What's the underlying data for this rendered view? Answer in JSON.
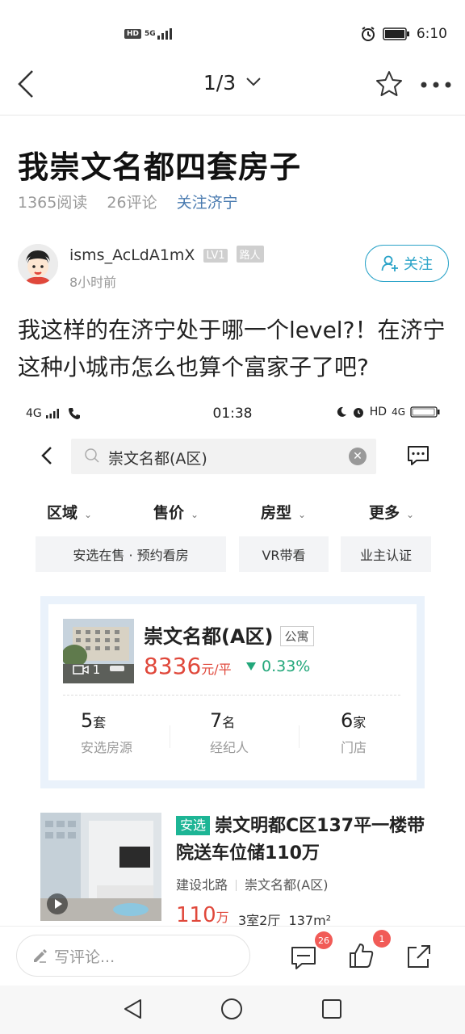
{
  "status_bar": {
    "hd": "HD",
    "network": "5G",
    "time": "6:10"
  },
  "nav": {
    "page_indicator": "1/3",
    "icons": [
      "back-icon",
      "chevron-down-icon",
      "star-icon",
      "more-icon"
    ]
  },
  "article": {
    "title": "我崇文名都四套房子",
    "reads": "1365阅读",
    "comments": "26评论",
    "follow_link": "关注济宁",
    "author": {
      "name": "isms_AcLdA1mX",
      "level": "LV1",
      "role": "路人",
      "time": "8小时前",
      "follow_label": "关注"
    },
    "body": "我这样的在济宁处于哪一个level?！在济宁这种小城市怎么也算个富家子了吧?"
  },
  "embedded": {
    "status": {
      "network": "4G",
      "time": "01:38",
      "hd": "HD",
      "lte": "4G"
    },
    "search": {
      "value": "崇文名都(A区)"
    },
    "filters": [
      "区域",
      "售价",
      "房型",
      "更多"
    ],
    "chips": [
      "安选在售 · 预约看房",
      "VR带看",
      "业主认证"
    ],
    "community": {
      "name": "崇文名都(A区)",
      "tag": "公寓",
      "video_count": "1",
      "price": "8336",
      "price_unit": "元/平",
      "change": "0.33%",
      "stats": [
        {
          "num": "5",
          "unit": "套",
          "label": "安选房源"
        },
        {
          "num": "7",
          "unit": "名",
          "label": "经纪人"
        },
        {
          "num": "6",
          "unit": "家",
          "label": "门店"
        }
      ]
    },
    "listing": {
      "tag": "安选",
      "title": "崇文明都C区137平一楼带院送车位储110万",
      "road": "建设北路",
      "community": "崇文名都(A区)",
      "price": "110",
      "price_unit": "万",
      "layout": "3室2厅",
      "area": "137m²"
    }
  },
  "bottom_bar": {
    "comment_placeholder": "写评论...",
    "comment_count": "26",
    "like_count": "1"
  },
  "colors": {
    "accent": "#2aa3c8",
    "price": "#e0483b",
    "down": "#22a77a",
    "anxuan": "#1db595",
    "badge": "#f15b57"
  }
}
